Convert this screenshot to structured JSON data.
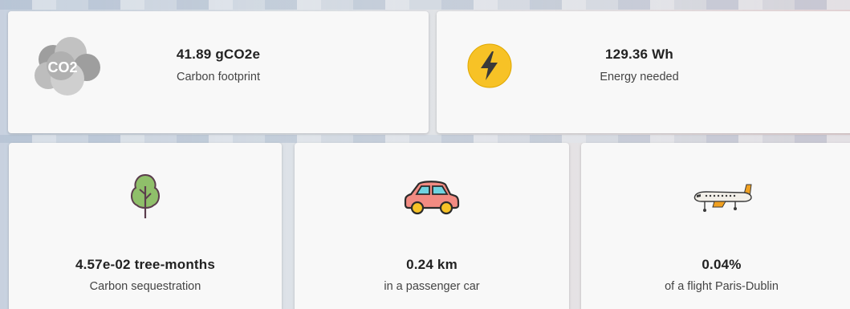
{
  "carbon": {
    "value": "41.89 gCO2e",
    "label": "Carbon footprint",
    "icon": "co2-cloud-icon",
    "icon_text": "CO2"
  },
  "energy": {
    "value": "129.36 Wh",
    "label": "Energy needed",
    "icon": "lightning-bolt-icon"
  },
  "tree": {
    "value": "4.57e-02 tree-months",
    "label": "Carbon sequestration",
    "icon": "tree-icon"
  },
  "car": {
    "value": "0.24 km",
    "label": "in a passenger car",
    "icon": "car-icon"
  },
  "flight": {
    "value": "0.04%",
    "label": "of a flight Paris-Dublin",
    "icon": "airplane-icon"
  },
  "colors": {
    "bolt": "#f7c226",
    "car": "#f28b82",
    "tree": "#8fbf6a",
    "cloud": "#b5b5b5"
  }
}
